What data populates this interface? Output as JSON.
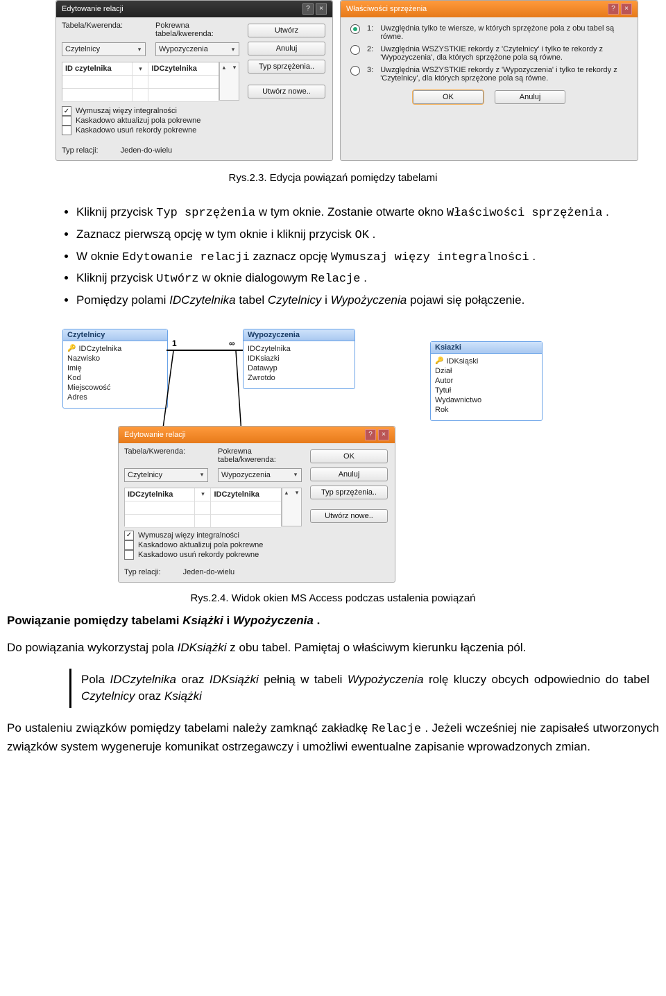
{
  "dlg_edit_rel": {
    "title": "Edytowanie relacji",
    "lbl_table": "Tabela/Kwerenda:",
    "lbl_related": "Pokrewna tabela/kwerenda:",
    "combo_left": "Czytelnicy",
    "combo_right": "Wypozyczenia",
    "field_left": "ID czytelnika",
    "field_right": "IDCzytelnika",
    "chk_integrity": "Wymuszaj więzy integralności",
    "chk_cascade_update": "Kaskadowo aktualizuj pola pokrewne",
    "chk_cascade_delete": "Kaskadowo usuń rekordy pokrewne",
    "lbl_reltype": "Typ relacji:",
    "reltype_value": "Jeden-do-wielu",
    "btn_create": "Utwórz",
    "btn_cancel": "Anuluj",
    "btn_jointype": "Typ sprzężenia..",
    "btn_create_new": "Utwórz nowe.."
  },
  "dlg_join": {
    "title": "Właściwości sprzężenia",
    "opt1_no": "1:",
    "opt1": "Uwzględnia tylko te wiersze, w których sprzężone pola z obu tabel są równe.",
    "opt2_no": "2:",
    "opt2": "Uwzględnia WSZYSTKIE rekordy z 'Czytelnicy' i tylko te rekordy z 'Wypozyczenia', dla których sprzężone pola są równe.",
    "opt3_no": "3:",
    "opt3": "Uwzględnia WSZYSTKIE rekordy z 'Wypozyczenia' i tylko te rekordy z 'Czytelnicy', dla których sprzężone pola są równe.",
    "btn_ok": "OK",
    "btn_cancel": "Anuluj"
  },
  "caption1": "Rys.2.3. Edycja powiązań pomiędzy tabelami",
  "bullets": {
    "b1a": "Kliknij przycisk ",
    "b1b": "Typ sprzężenia",
    "b1c": " w tym oknie. Zostanie otwarte okno ",
    "b1d": "Właściwości sprzężenia",
    "b1e": ".",
    "b2a": "Zaznacz pierwszą opcję w tym oknie i kliknij przycisk ",
    "b2b": "OK",
    "b2c": ".",
    "b3a": "W oknie ",
    "b3b": "Edytowanie relacji",
    "b3c": " zaznacz opcję ",
    "b3d": "Wymuszaj więzy integralności",
    "b3e": ".",
    "b4a": "Kliknij przycisk ",
    "b4b": "Utwórz",
    "b4c": " w oknie dialogowym ",
    "b4d": "Relacje",
    "b4e": ".",
    "b5a": "Pomiędzy polami ",
    "b5b": "IDCzytelnika",
    "b5c": " tabel ",
    "b5d": "Czytelnicy",
    "b5e": " i ",
    "b5f": "Wypożyczenia",
    "b5g": " pojawi się połączenie."
  },
  "tables": {
    "czytelnicy": {
      "title": "Czytelnicy",
      "fields": [
        "IDCzytelnika",
        "Nazwisko",
        "Imię",
        "Kod",
        "Miejscowość",
        "Adres"
      ],
      "key_index": 0
    },
    "wypozyczenia": {
      "title": "Wypozyczenia",
      "fields": [
        "IDCzytelnika",
        "IDKsiazki",
        "Datawyp",
        "Zwrotdo"
      ]
    },
    "ksiazki": {
      "title": "Ksiazki",
      "fields": [
        "IDKsiąski",
        "Dział",
        "Autor",
        "Tytuł",
        "Wydawnictwo",
        "Rok"
      ],
      "key_index": 0
    },
    "rel_one": "1",
    "rel_many": "∞"
  },
  "dlg_edit_rel2": {
    "title": "Edytowanie relacji",
    "combo_left": "Czytelnicy",
    "combo_right": "Wypozyczenia",
    "field_left": "IDCzytelnika",
    "field_right": "IDCzytelnika",
    "btn_ok": "OK"
  },
  "caption2": "Rys.2.4. Widok okien MS Access podczas ustalenia powiązań",
  "section2": {
    "h_a": "Powiązanie pomiędzy tabelami ",
    "h_b": "Książki",
    "h_c": " i ",
    "h_d": "Wypożyczenia",
    "h_e": ".",
    "p1a": "Do powiązania wykorzystaj pola  ",
    "p1b": "IDKsiążki",
    "p1c": " z obu tabel. Pamiętaj o właściwym kierunku  łączenia pól.",
    "q1a": "Pola ",
    "q1b": "IDCzytelnika",
    "q1c": " oraz ",
    "q1d": "IDKsiążki",
    "q1e": " pełnią w tabeli ",
    "q1f": "Wypożyczenia",
    "q1g": " rolę kluczy obcych odpowiednio do tabel ",
    "q1h": "Czytelnicy",
    "q1i": " oraz ",
    "q1j": "Książki",
    "p2a": "Po ustaleniu związków pomiędzy tabelami należy zamknąć zakładkę ",
    "p2b": "Relacje",
    "p2c": ".  Jeżeli wcześniej nie zapisałeś utworzonych związków system wygeneruje komunikat ostrzegawczy i umożliwi ewentualne zapisanie wprowadzonych zmian."
  }
}
